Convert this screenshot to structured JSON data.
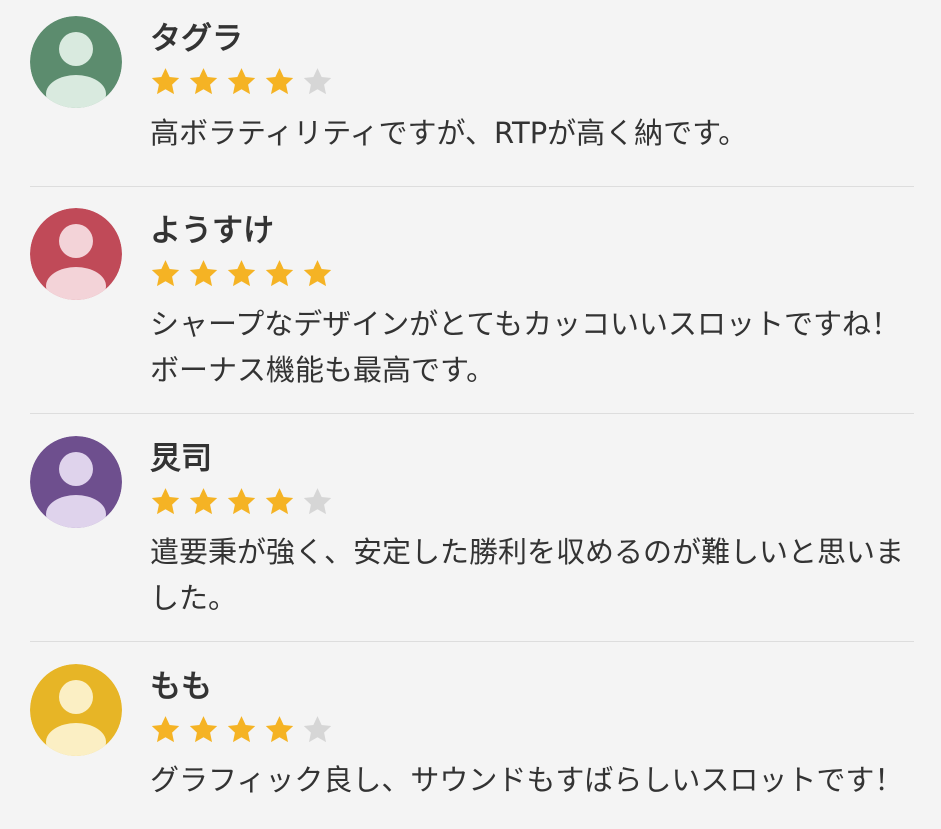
{
  "colors": {
    "star_filled": "#f5b324",
    "star_empty": "#d6d6d6",
    "text": "#333333",
    "divider": "#dddddd",
    "background": "#f4f4f4"
  },
  "reviews": [
    {
      "name": "タグラ",
      "rating": 4,
      "max_rating": 5,
      "avatar_icon": "user-avatar-icon",
      "avatar_bg": "#5c8c6e",
      "avatar_fg": "#d9eadf",
      "comment": "高ボラティリティですが、RTPが高く納です。"
    },
    {
      "name": "ようすけ",
      "rating": 5,
      "max_rating": 5,
      "avatar_icon": "user-avatar-icon",
      "avatar_bg": "#c04a58",
      "avatar_fg": "#f3d3d8",
      "comment": "シャープなデザインがとてもカッコいいスロットですね！ボーナス機能も最高です。"
    },
    {
      "name": "炅司",
      "rating": 4,
      "max_rating": 5,
      "avatar_icon": "user-avatar-icon",
      "avatar_bg": "#6e4f8e",
      "avatar_fg": "#dfd3ec",
      "comment": "遣要秉が強く、安定した勝利を収めるのが難しいと思いました。"
    },
    {
      "name": "もも",
      "rating": 4,
      "max_rating": 5,
      "avatar_icon": "user-avatar-icon",
      "avatar_bg": "#e7b526",
      "avatar_fg": "#fbefc4",
      "comment": "グラフィック良し、サウンドもすばらしいスロットです！"
    }
  ]
}
